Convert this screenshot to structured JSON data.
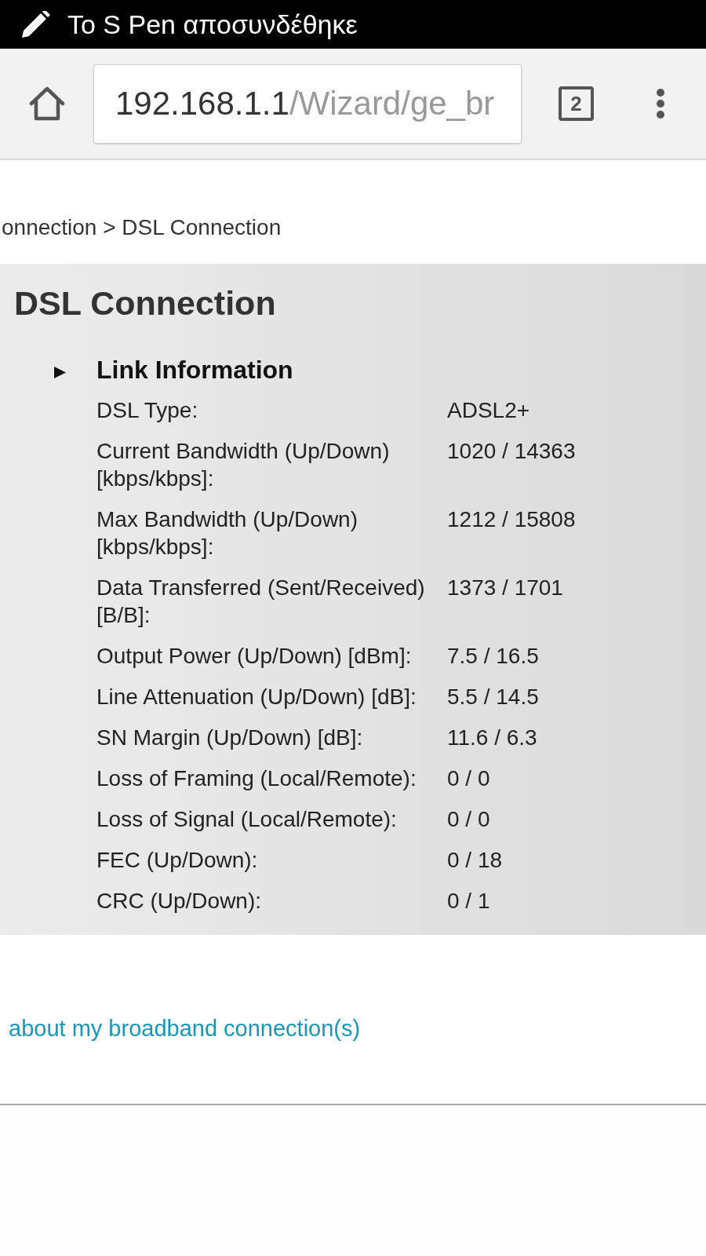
{
  "status_bar": {
    "notification": "To S Pen αποσυνδέθηκε"
  },
  "browser": {
    "url_host": "192.168.1.1",
    "url_path": "/Wizard/ge_br",
    "tab_count": "2"
  },
  "breadcrumb": "onnection > DSL Connection",
  "panel": {
    "title": "DSL Connection",
    "section": {
      "title": "Link Information",
      "rows": [
        {
          "label": "DSL Type:",
          "value": "ADSL2+"
        },
        {
          "label": "Current Bandwidth (Up/Down) [kbps/kbps]:",
          "value": "1020 / 14363"
        },
        {
          "label": "Max Bandwidth (Up/Down) [kbps/kbps]:",
          "value": "1212 / 15808"
        },
        {
          "label": "Data Transferred (Sent/Received) [B/B]:",
          "value": "1373 / 1701"
        },
        {
          "label": "Output Power (Up/Down) [dBm]:",
          "value": "7.5 / 16.5"
        },
        {
          "label": "Line Attenuation (Up/Down) [dB]:",
          "value": "5.5 / 14.5"
        },
        {
          "label": "SN Margin (Up/Down) [dB]:",
          "value": "11.6 / 6.3"
        },
        {
          "label": "Loss of Framing (Local/Remote):",
          "value": "0 / 0"
        },
        {
          "label": "Loss of Signal (Local/Remote):",
          "value": "0 / 0"
        },
        {
          "label": "FEC (Up/Down):",
          "value": "0 / 18"
        },
        {
          "label": "CRC (Up/Down):",
          "value": "0 / 1"
        }
      ]
    }
  },
  "link": "about my broadband connection(s)"
}
